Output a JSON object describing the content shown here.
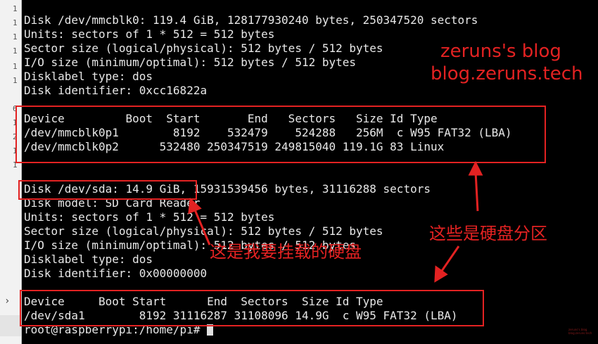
{
  "gutter": {
    "line_numbers": [
      "1",
      "1",
      "1",
      "1",
      "1",
      "1",
      "6",
      "1",
      "2",
      "1",
      "1"
    ]
  },
  "terminal": {
    "lines": [
      "Disk /dev/mmcblk0: 119.4 GiB, 128177930240 bytes, 250347520 sectors",
      "Units: sectors of 1 * 512 = 512 bytes",
      "Sector size (logical/physical): 512 bytes / 512 bytes",
      "I/O size (minimum/optimal): 512 bytes / 512 bytes",
      "Disklabel type: dos",
      "Disk identifier: 0xcc16822a",
      "",
      "Device         Boot  Start       End   Sectors   Size Id Type",
      "/dev/mmcblk0p1        8192    532479    524288   256M  c W95 FAT32 (LBA)",
      "/dev/mmcblk0p2      532480 250347519 249815040 119.1G 83 Linux",
      "",
      "",
      "Disk /dev/sda: 14.9 GiB, 15931539456 bytes, 31116288 sectors",
      "Disk model: SD Card Reader",
      "Units: sectors of 1 * 512 = 512 bytes",
      "Sector size (logical/physical): 512 bytes / 512 bytes",
      "I/O size (minimum/optimal): 512 bytes / 512 bytes",
      "Disklabel type: dos",
      "Disk identifier: 0x00000000",
      "",
      "Device     Boot Start      End  Sectors  Size Id Type",
      "/dev/sda1        8192 31116287 31108096 14.9G  c W95 FAT32 (LBA)"
    ],
    "prompt": "root@raspberrypi:/home/pi# "
  },
  "annotations": {
    "blog_name": "zeruns's blog",
    "blog_url": "blog.zeruns.tech",
    "partitions_note": "这些是硬盘分区",
    "mount_note": "这是我要挂载的硬盘",
    "color": "#e32222"
  },
  "watermark": [
    "zeruns's blog",
    "blog.zeruns.tech"
  ],
  "colors": {
    "background": "#000000",
    "text": "#e8e8e8",
    "annotation": "#e32222"
  }
}
